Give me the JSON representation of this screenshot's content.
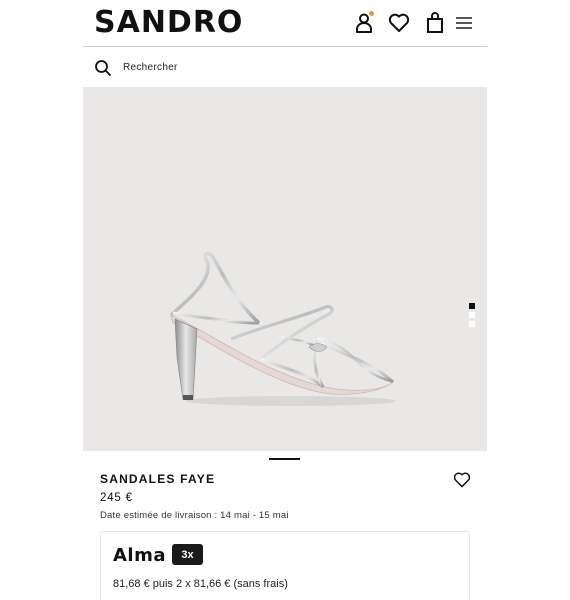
{
  "header": {
    "logo": "SANDRO",
    "notification_dot_color": "#e8924a"
  },
  "search": {
    "placeholder": "Rechercher"
  },
  "gallery": {
    "background_color": "#e9e8e6",
    "image_count": 3,
    "active_index": 0
  },
  "product": {
    "name": "SANDALES FAYE",
    "price": "245 €",
    "delivery": "Date estimée de livraison : 14 mai - 15 mai"
  },
  "alma": {
    "logo": "Alma",
    "badge": "3x",
    "text": "81,68 € puis 2 x 81,66 € (sans frais)"
  }
}
